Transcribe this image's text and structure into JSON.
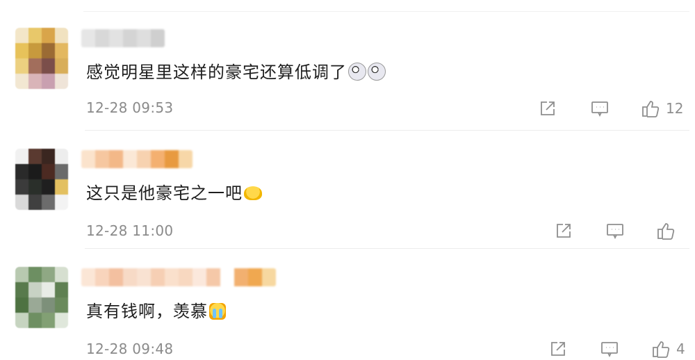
{
  "comments": [
    {
      "text": "感觉明星里这样的豪宅还算低调了",
      "emojis": [
        "surprised-face-emoji",
        "surprised-face-emoji"
      ],
      "time": "12-28 09:53",
      "likes": "12"
    },
    {
      "text": "这只是他豪宅之一吧",
      "emojis": [
        "shrug-emoji"
      ],
      "time": "12-28 11:00",
      "likes": ""
    },
    {
      "text": "真有钱啊，羡慕",
      "emojis": [
        "crying-face-emoji"
      ],
      "time": "12-28 09:48",
      "likes": "4"
    }
  ],
  "icons": {
    "share": "share-icon",
    "reply": "comment-icon",
    "like": "thumbs-up-icon"
  },
  "colors": {
    "text": "#1e1e1e",
    "meta": "#8a8a8a",
    "icon": "#8e8e8e",
    "divider": "#ececec"
  }
}
